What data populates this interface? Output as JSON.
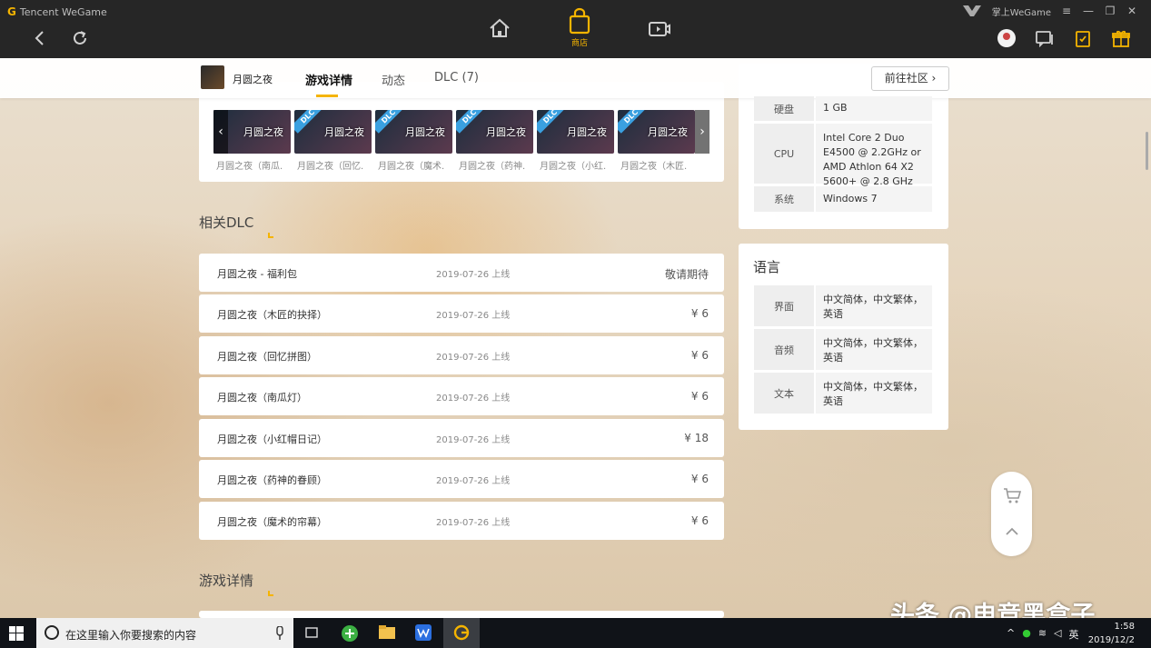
{
  "app": {
    "brand": "Tencent WeGame",
    "palm_label": "掌上WeGame",
    "nav_store_label": "商店"
  },
  "game": {
    "name": "月圆之夜"
  },
  "tabs": [
    {
      "label": "游戏详情"
    },
    {
      "label": "动态"
    },
    {
      "label": "DLC (7)"
    }
  ],
  "community_button": "前往社区 ›",
  "dlc_thumbs": [
    {
      "title": "月圆之夜",
      "caption": "月圆之夜（南瓜..."
    },
    {
      "title": "月圆之夜",
      "caption": "月圆之夜（回忆..."
    },
    {
      "title": "月圆之夜",
      "caption": "月圆之夜（魔术..."
    },
    {
      "title": "月圆之夜",
      "caption": "月圆之夜（药神..."
    },
    {
      "title": "月圆之夜",
      "caption": "月圆之夜（小红..."
    },
    {
      "title": "月圆之夜",
      "caption": "月圆之夜（木匠..."
    }
  ],
  "dlc_badge": "DLC",
  "related_dlc_title": "相关DLC",
  "dlc_list": [
    {
      "name": "月圆之夜 - 福利包",
      "date": "2019-07-26 上线",
      "price": "敬请期待"
    },
    {
      "name": "月圆之夜（木匠的抉择）",
      "date": "2019-07-26 上线",
      "price": "¥ 6"
    },
    {
      "name": "月圆之夜（回忆拼图）",
      "date": "2019-07-26 上线",
      "price": "¥ 6"
    },
    {
      "name": "月圆之夜（南瓜灯）",
      "date": "2019-07-26 上线",
      "price": "¥ 6"
    },
    {
      "name": "月圆之夜（小红帽日记）",
      "date": "2019-07-26 上线",
      "price": "¥ 18"
    },
    {
      "name": "月圆之夜（药神的眷顾）",
      "date": "2019-07-26 上线",
      "price": "¥ 6"
    },
    {
      "name": "月圆之夜（魔术的帘幕）",
      "date": "2019-07-26 上线",
      "price": "¥ 6"
    }
  ],
  "game_detail_title": "游戏详情",
  "specs": [
    {
      "key": "硬盘",
      "value": "1 GB"
    },
    {
      "key": "CPU",
      "value": "Intel Core 2 Duo E4500 @ 2.2GHz or AMD Athlon 64 X2 5600+ @ 2.8 GHz"
    },
    {
      "key": "系统",
      "value": "Windows 7"
    }
  ],
  "language": {
    "title": "语言",
    "rows": [
      {
        "key": "界面",
        "value": "中文简体，中文繁体，英语"
      },
      {
        "key": "音频",
        "value": "中文简体，中文繁体，英语"
      },
      {
        "key": "文本",
        "value": "中文简体，中文繁体，英语"
      }
    ]
  },
  "taskbar": {
    "search_placeholder": "在这里输入你要搜索的内容",
    "ime": "英",
    "time": "1:58",
    "date": "2019/12/2"
  },
  "watermark": "头条 @电竞黑盒子",
  "colors": {
    "accent": "#f5b400",
    "topbar": "#262626",
    "dlc_badge": "#3aa0e0"
  }
}
